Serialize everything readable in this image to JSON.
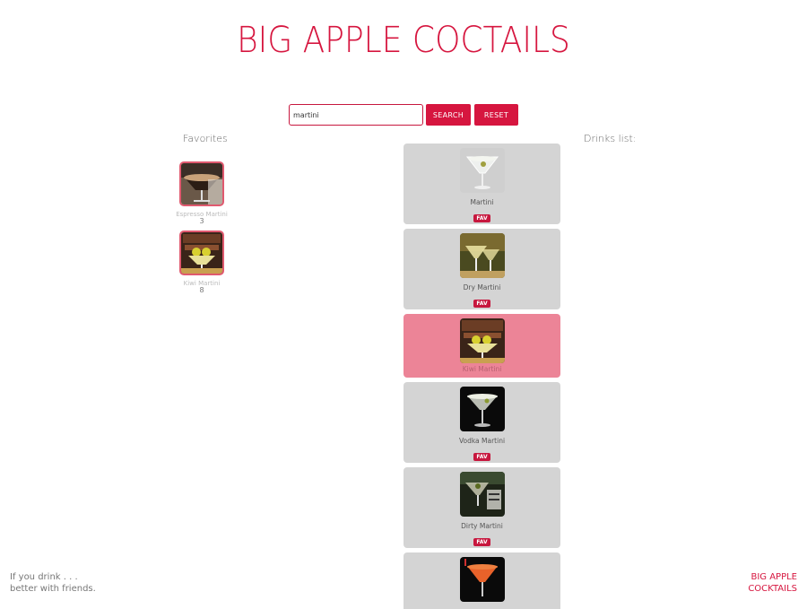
{
  "header": {
    "title": "BIG APPLE COCTAILS"
  },
  "search": {
    "value": "martini",
    "search_label": "SEARCH",
    "reset_label": "RESET"
  },
  "favorites": {
    "heading": "Favorites",
    "items": [
      {
        "name": "Espresso Martini",
        "count": "3"
      },
      {
        "name": "Kiwi Martini",
        "count": "8"
      }
    ]
  },
  "drinks": {
    "heading": "Drinks list:",
    "fav_label": "FAV",
    "items": [
      {
        "name": "Martini"
      },
      {
        "name": "Dry Martini"
      },
      {
        "name": "Kiwi Martini"
      },
      {
        "name": "Vodka Martini"
      },
      {
        "name": "Dirty Martini"
      }
    ]
  },
  "footer": {
    "tagline_line1": "If you drink . . .",
    "tagline_line2": "better with friends.",
    "brand_line1": "BIG APPLE",
    "brand_line2": "COCKTAILS"
  },
  "colors": {
    "accent": "#d6163f",
    "card": "#d4d4d4",
    "selected_card": "#ec8497"
  }
}
